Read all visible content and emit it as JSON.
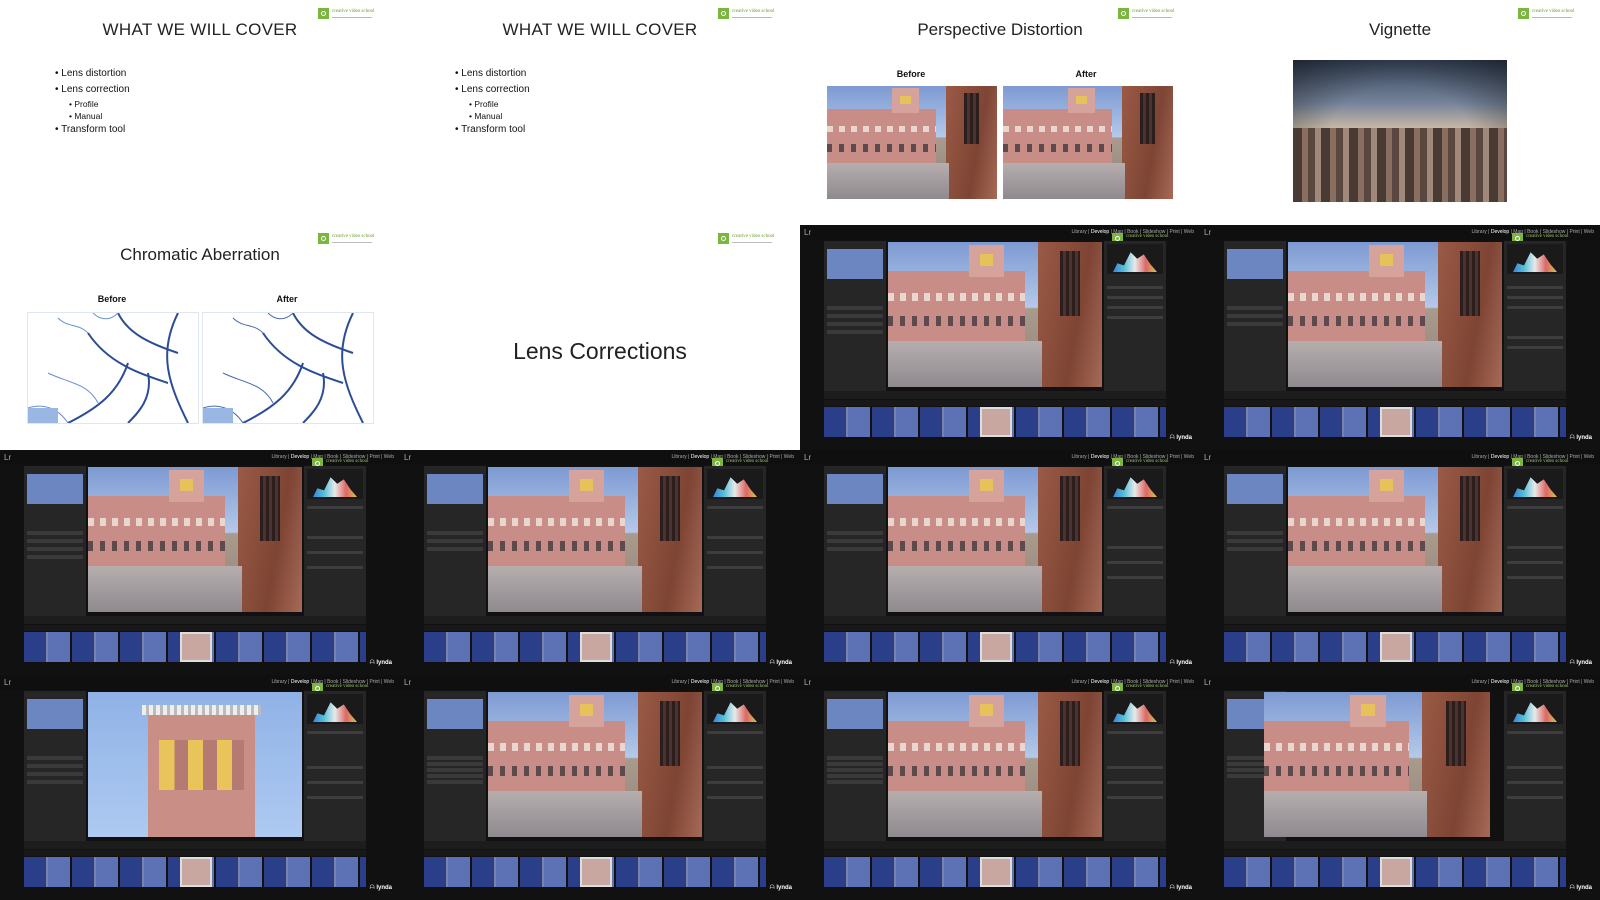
{
  "logo_text": "creative video school",
  "footer": "",
  "slides": {
    "cover1": {
      "title": "WHAT WE WILL COVER",
      "b1": "Lens distortion",
      "b2": "Lens correction",
      "b2a": "Profile",
      "b2b": "Manual",
      "b3": "Transform tool"
    },
    "cover2": {
      "title": "WHAT WE WILL COVER",
      "b1": "Lens distortion",
      "b2": "Lens correction",
      "b2a": "Profile",
      "b2b": "Manual",
      "b3": "Transform tool"
    },
    "perspective": {
      "title": "Perspective Distortion",
      "before": "Before",
      "after": "After"
    },
    "vignette": {
      "title": "Vignette"
    },
    "chromatic": {
      "title": "Chromatic Aberration",
      "before": "Before",
      "after": "After"
    },
    "lens": {
      "title": "Lens Corrections"
    }
  },
  "lightroom": {
    "logo": "Lr",
    "modules": [
      "Library",
      "Develop",
      "Map",
      "Book",
      "Slideshow",
      "Print",
      "Web"
    ],
    "active_module": "Develop",
    "watermark_prefix": "ᗩ",
    "watermark": "lynda"
  },
  "colors": {
    "logo_green": "#7ab640",
    "lr_bg": "#111111",
    "slide_bg": "#ffffff"
  }
}
